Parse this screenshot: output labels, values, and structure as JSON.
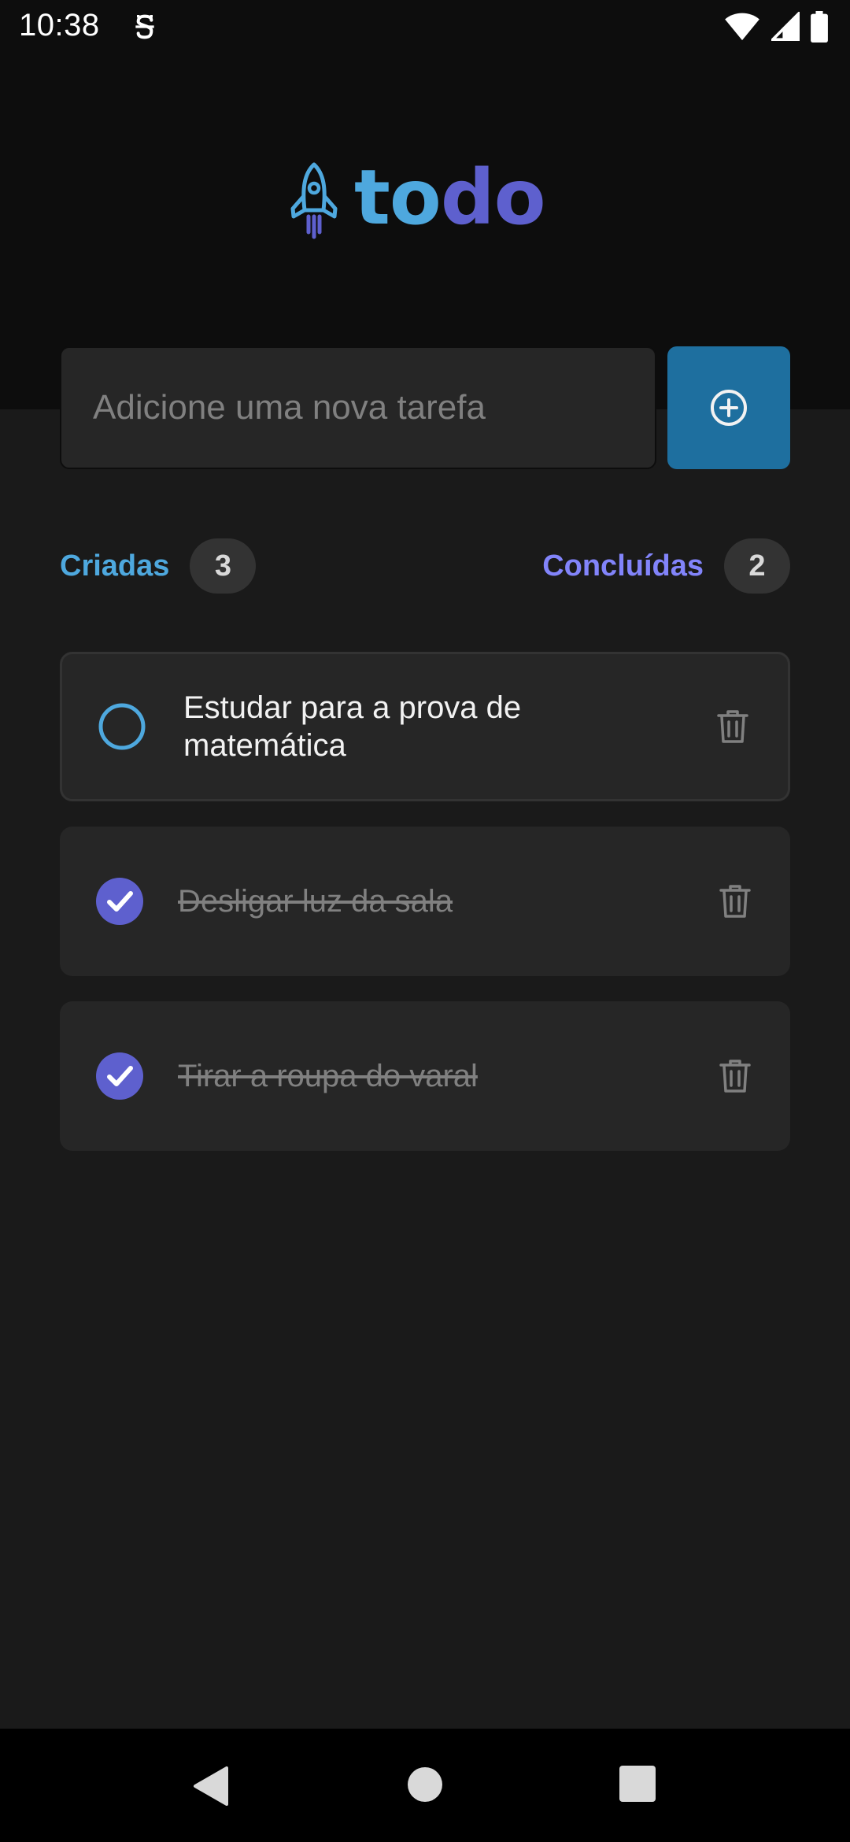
{
  "status_bar": {
    "time": "10:38"
  },
  "app": {
    "logo_part1": "to",
    "logo_part2": "do",
    "colors": {
      "blue": "#4ea8de",
      "purple": "#5e60ce",
      "purple_light": "#8284fa",
      "button_blue": "#1e6f9f"
    }
  },
  "new_task": {
    "placeholder": "Adicione uma nova tarefa",
    "value": ""
  },
  "counters": {
    "created_label": "Criadas",
    "created_count": "3",
    "done_label": "Concluídas",
    "done_count": "2"
  },
  "tasks": [
    {
      "text": "Estudar para a prova de matemática",
      "completed": false
    },
    {
      "text": "Desligar luz da sala",
      "completed": true
    },
    {
      "text": "Tirar a roupa do varal",
      "completed": true
    }
  ],
  "icons": {
    "status_app": "app-notification-icon",
    "wifi": "wifi-icon",
    "signal": "cell-signal-icon",
    "battery": "battery-icon",
    "logo": "rocket-icon",
    "add": "plus-circle-icon",
    "delete": "trash-icon",
    "nav_back": "back-triangle-icon",
    "nav_home": "home-circle-icon",
    "nav_recent": "recent-square-icon"
  }
}
